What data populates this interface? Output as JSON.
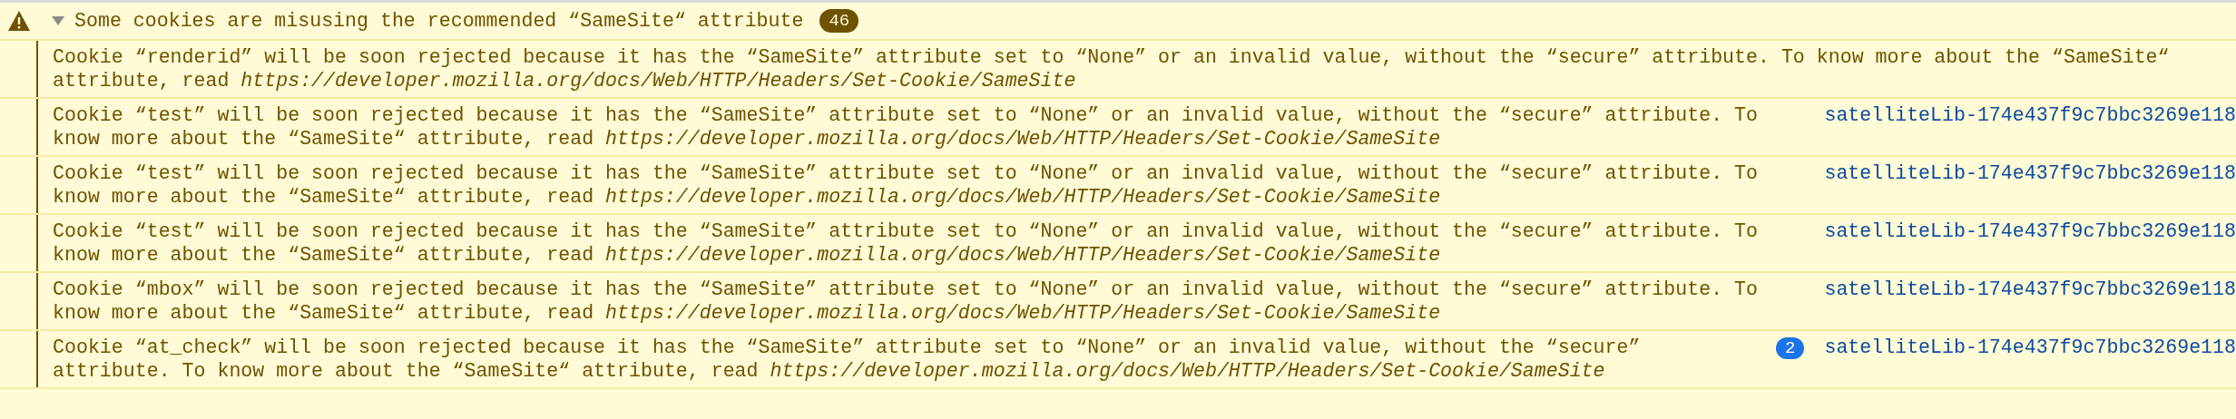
{
  "group": {
    "title": "Some cookies are misusing the recommended “SameSite“ attribute",
    "count": "46",
    "expanded": true
  },
  "messages": [
    {
      "text": "Cookie “renderid” will be soon rejected because it has the “SameSite” attribute set to “None” or an invalid value, without the “secure” attribute. To know more about the “SameSite“ attribute, read *https://developer.mozilla.org/docs/Web/HTTP/Headers/Set-Cookie/SameSite*"
    },
    {
      "text": "Cookie “test” will be soon rejected because it has the “SameSite” attribute set to “None” or an invalid value, without the “secure” attribute. To know more about the “SameSite“ attribute, read *https://developer.mozilla.org/docs/Web/HTTP/Headers/Set-Cookie/SameSite*",
      "source": "satelliteLib-174e437f9c7bbc3269e118"
    },
    {
      "text": "Cookie “test” will be soon rejected because it has the “SameSite” attribute set to “None” or an invalid value, without the “secure” attribute. To know more about the “SameSite“ attribute, read *https://developer.mozilla.org/docs/Web/HTTP/Headers/Set-Cookie/SameSite*",
      "source": "satelliteLib-174e437f9c7bbc3269e118"
    },
    {
      "text": "Cookie “test” will be soon rejected because it has the “SameSite” attribute set to “None” or an invalid value, without the “secure” attribute. To know more about the “SameSite“ attribute, read *https://developer.mozilla.org/docs/Web/HTTP/Headers/Set-Cookie/SameSite*",
      "source": "satelliteLib-174e437f9c7bbc3269e118"
    },
    {
      "text": "Cookie “mbox” will be soon rejected because it has the “SameSite” attribute set to “None” or an invalid value, without the “secure” attribute. To know more about the “SameSite“ attribute, read *https://developer.mozilla.org/docs/Web/HTTP/Headers/Set-Cookie/SameSite*",
      "source": "satelliteLib-174e437f9c7bbc3269e118"
    },
    {
      "text": "Cookie “at_check” will be soon rejected because it has the “SameSite” attribute set to “None” or an invalid value, without the “secure” attribute. To know more about the “SameSite“ attribute, read *https://developer.mozilla.org/docs/Web/HTTP/Headers/Set-Cookie/SameSite*",
      "source": "satelliteLib-174e437f9c7bbc3269e118",
      "repeat": "2"
    }
  ]
}
